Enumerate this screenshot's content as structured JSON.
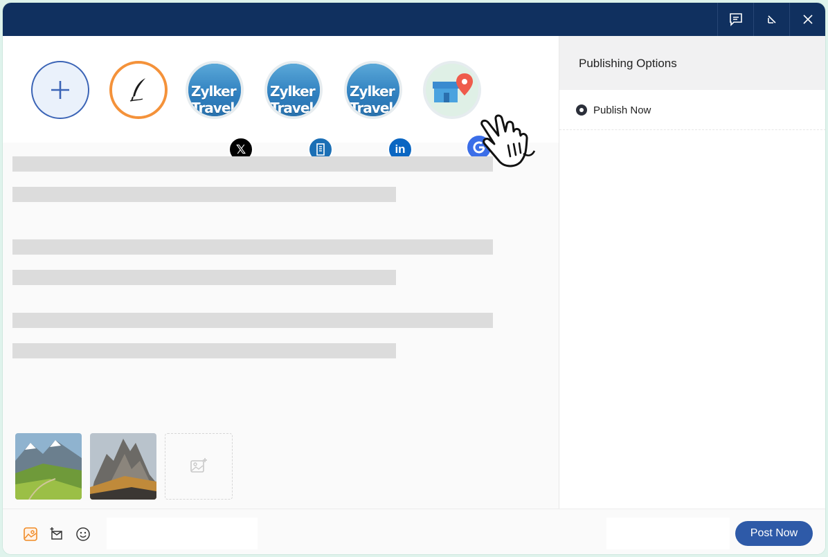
{
  "header": {
    "buttons": [
      {
        "icon": "comment-icon"
      },
      {
        "icon": "collapse-arrow-icon"
      },
      {
        "icon": "close-icon"
      }
    ],
    "background": "#10305f"
  },
  "channels": {
    "add_icon": "plus-icon",
    "compose_icon": "quill-pen-icon",
    "profiles": [
      {
        "brand_line1": "Zylker",
        "brand_line2": "Travel",
        "network": "x-twitter",
        "badge_label": "𝕏",
        "badge_color": "#000000"
      },
      {
        "brand_line1": "Zylker",
        "brand_line2": "Travel",
        "network": "building-page",
        "badge_label": "",
        "badge_color": "#1b6fb5"
      },
      {
        "brand_line1": "Zylker",
        "brand_line2": "Travel",
        "network": "linkedin",
        "badge_label": "in",
        "badge_color": "#0a66c2"
      }
    ],
    "google_business": {
      "icon": "store-location-icon",
      "badge": "google-icon"
    }
  },
  "publishing": {
    "title": "Publishing Options",
    "option": "Publish Now",
    "selected": true
  },
  "footer": {
    "icons": [
      "image-icon",
      "new-message-icon",
      "emoji-icon"
    ],
    "post_label": "Post Now",
    "accent": "#2e5aa8"
  }
}
